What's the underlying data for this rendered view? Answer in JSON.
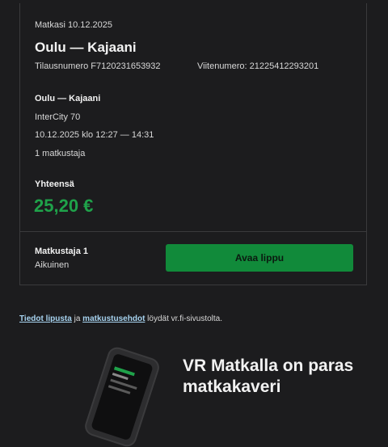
{
  "order": {
    "trip_date": "Matkasi 10.12.2025",
    "route_title": "Oulu — Kajaani",
    "order_number": "Tilausnumero F7120231653932",
    "reference_number": "Viitenumero: 21225412293201"
  },
  "segment": {
    "route": "Oulu — Kajaani",
    "train": "InterCity 70",
    "time": "10.12.2025 klo 12:27 — 14:31",
    "passengers": "1 matkustaja"
  },
  "total": {
    "label": "Yhteensä",
    "value": "25,20 €"
  },
  "traveller": {
    "name": "Matkustaja 1",
    "type": "Aikuinen",
    "open_ticket_label": "Avaa lippu"
  },
  "footer": {
    "ticket_info_link": "Tiedot lipusta",
    "and_text": " ja ",
    "terms_link": "matkustusehdot",
    "suffix": " löydät vr.fi-sivustolta."
  },
  "promo": {
    "headline": "VR Matkalla on paras matkakaveri"
  },
  "colors": {
    "background": "#1c1c1e",
    "accent_green": "#1fa24a",
    "button_green": "#118a3a",
    "link": "#a7d3f0"
  }
}
